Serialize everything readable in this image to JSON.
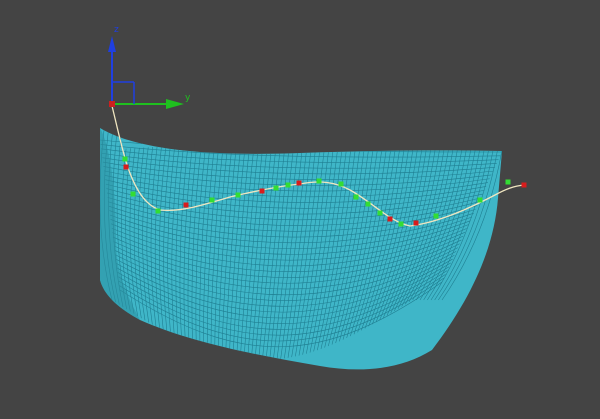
{
  "viewport": {
    "background": "#444444"
  },
  "gizmo": {
    "z_label": "z",
    "y_label": "y",
    "z_color": "#1f3fe0",
    "y_color": "#1fc01f",
    "pivot_color": "#cc2020"
  },
  "surface": {
    "mesh_color": "#3fb6c8",
    "line_color": "#1f7f92"
  },
  "spline": {
    "line_color": "#f0e6c0",
    "vertex_color": "#d81c1c",
    "handle_color": "#33dd33"
  }
}
